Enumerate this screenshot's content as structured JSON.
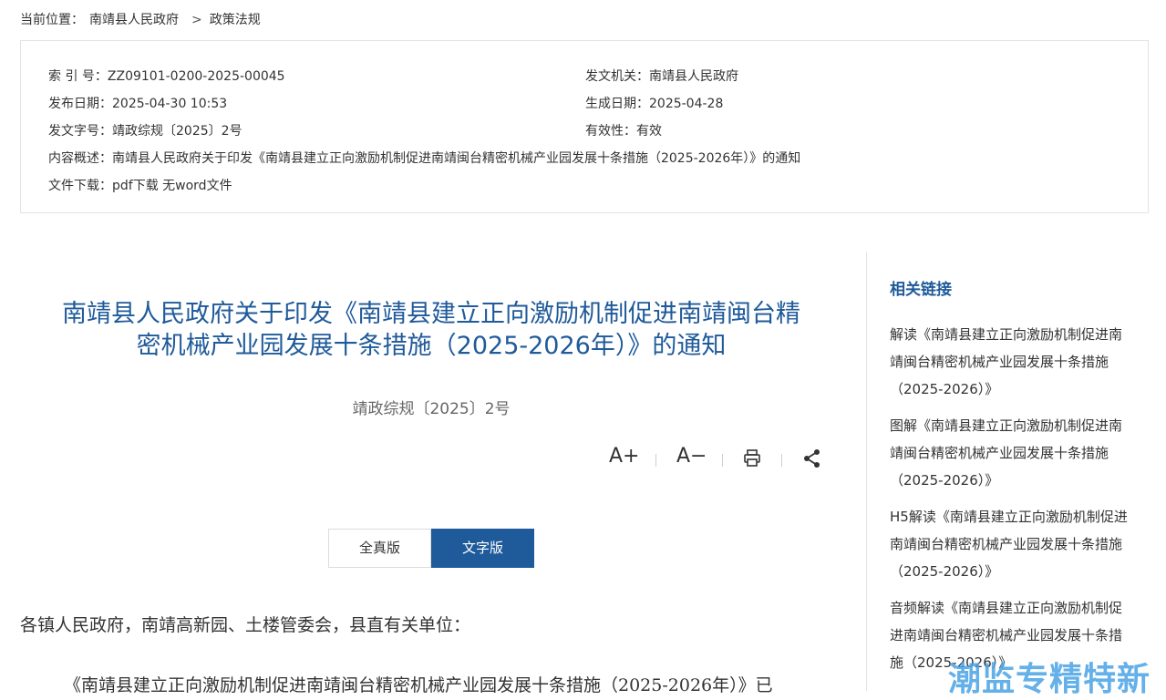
{
  "breadcrumb": {
    "prefix": "当前位置：",
    "items": [
      "南靖县人民政府",
      "政策法规"
    ],
    "separator": ">"
  },
  "meta": {
    "index_label": "索 引 号：",
    "index_value": "ZZ09101-0200-2025-00045",
    "issuer_label": "发文机关：",
    "issuer_value": "南靖县人民政府",
    "publish_label": "发布日期：",
    "publish_value": "2025-04-30 10:53",
    "created_label": "生成日期：",
    "created_value": "2025-04-28",
    "docno_label": "发文字号：",
    "docno_value": "靖政综规〔2025〕2号",
    "validity_label": "有效性：",
    "validity_value": "有效",
    "summary_label": "内容概述：",
    "summary_value": "南靖县人民政府关于印发《南靖县建立正向激励机制促进南靖闽台精密机械产业园发展十条措施（2025-2026年）》的通知",
    "download_label": "文件下载：",
    "download_pdf": "pdf下载",
    "download_word": "无word文件"
  },
  "article": {
    "title_line1": "南靖县人民政府关于印发《南靖县建立正向激励机制促进南靖闽台精",
    "title_line2": "密机械产业园发展十条措施（2025-2026年）》的通知",
    "doc_number": "靖政综规〔2025〕2号",
    "tools": {
      "font_up": "A+",
      "font_down": "A−",
      "print_icon": "print-icon",
      "share_icon": "share-icon"
    },
    "tabs": [
      "全真版",
      "文字版"
    ],
    "active_tab": "文字版",
    "salutation": "各镇人民政府，南靖高新园、土楼管委会，县直有关单位：",
    "para1": "《南靖县建立正向激励机制促进南靖闽台精密机械产业园发展十条措施（2025-2026年）》已"
  },
  "sidebar": {
    "title": "相关链接",
    "links": [
      [
        "解读《南靖县建立正向激励机制促进南",
        "靖闽台精密机械产业园发展十条措施",
        "（2025-2026）》"
      ],
      [
        "图解《南靖县建立正向激励机制促进南",
        "靖闽台精密机械产业园发展十条措施",
        "（2025-2026）》"
      ],
      [
        "H5解读《南靖县建立正向激励机制促进",
        "南靖闽台精密机械产业园发展十条措施",
        "（2025-2026）》"
      ],
      [
        "音频解读《南靖县建立正向激励机制促",
        "进南靖闽台精密机械产业园发展十条措",
        "施（2025-2026）》"
      ]
    ]
  },
  "watermark": "潮监专精特新",
  "colors": {
    "brand": "#1f5a9a",
    "border": "#e3e3e3"
  }
}
